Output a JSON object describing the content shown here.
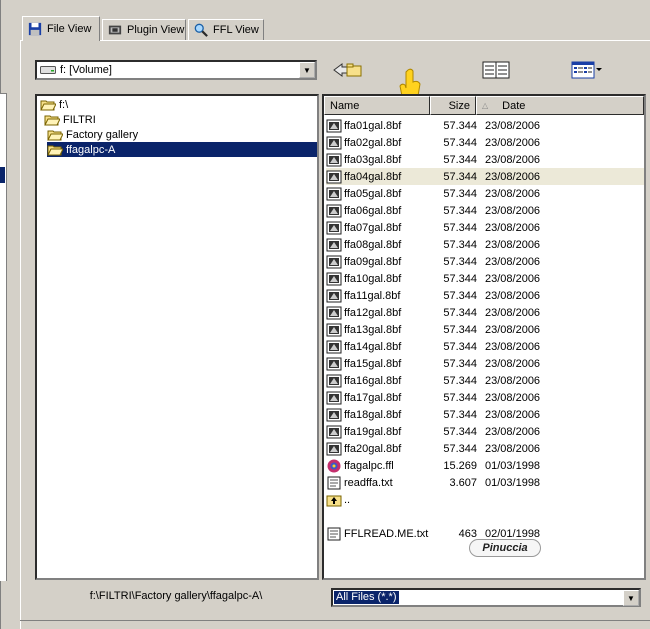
{
  "tabs": [
    {
      "label": "File View",
      "icon": "floppy-disk-icon"
    },
    {
      "label": "Plugin View",
      "icon": "plugin-icon"
    },
    {
      "label": "FFL View",
      "icon": "magnifier-icon"
    }
  ],
  "drive": {
    "label": "f: [Volume]"
  },
  "tree": [
    {
      "label": "f:\\",
      "level": 0
    },
    {
      "label": "FILTRI",
      "level": 1
    },
    {
      "label": "Factory gallery",
      "level": 2
    },
    {
      "label": "ffagalpc-A",
      "level": 3,
      "selected": true
    }
  ],
  "list_headers": {
    "name": "Name",
    "size": "Size",
    "date": "Date"
  },
  "files": [
    {
      "name": "ffa01gal.8bf",
      "size": "57.344",
      "date": "23/08/2006",
      "type": "plugin"
    },
    {
      "name": "ffa02gal.8bf",
      "size": "57.344",
      "date": "23/08/2006",
      "type": "plugin"
    },
    {
      "name": "ffa03gal.8bf",
      "size": "57.344",
      "date": "23/08/2006",
      "type": "plugin"
    },
    {
      "name": "ffa04gal.8bf",
      "size": "57.344",
      "date": "23/08/2006",
      "type": "plugin",
      "hover": true
    },
    {
      "name": "ffa05gal.8bf",
      "size": "57.344",
      "date": "23/08/2006",
      "type": "plugin"
    },
    {
      "name": "ffa06gal.8bf",
      "size": "57.344",
      "date": "23/08/2006",
      "type": "plugin"
    },
    {
      "name": "ffa07gal.8bf",
      "size": "57.344",
      "date": "23/08/2006",
      "type": "plugin"
    },
    {
      "name": "ffa08gal.8bf",
      "size": "57.344",
      "date": "23/08/2006",
      "type": "plugin"
    },
    {
      "name": "ffa09gal.8bf",
      "size": "57.344",
      "date": "23/08/2006",
      "type": "plugin"
    },
    {
      "name": "ffa10gal.8bf",
      "size": "57.344",
      "date": "23/08/2006",
      "type": "plugin"
    },
    {
      "name": "ffa11gal.8bf",
      "size": "57.344",
      "date": "23/08/2006",
      "type": "plugin"
    },
    {
      "name": "ffa12gal.8bf",
      "size": "57.344",
      "date": "23/08/2006",
      "type": "plugin"
    },
    {
      "name": "ffa13gal.8bf",
      "size": "57.344",
      "date": "23/08/2006",
      "type": "plugin"
    },
    {
      "name": "ffa14gal.8bf",
      "size": "57.344",
      "date": "23/08/2006",
      "type": "plugin"
    },
    {
      "name": "ffa15gal.8bf",
      "size": "57.344",
      "date": "23/08/2006",
      "type": "plugin"
    },
    {
      "name": "ffa16gal.8bf",
      "size": "57.344",
      "date": "23/08/2006",
      "type": "plugin"
    },
    {
      "name": "ffa17gal.8bf",
      "size": "57.344",
      "date": "23/08/2006",
      "type": "plugin"
    },
    {
      "name": "ffa18gal.8bf",
      "size": "57.344",
      "date": "23/08/2006",
      "type": "plugin"
    },
    {
      "name": "ffa19gal.8bf",
      "size": "57.344",
      "date": "23/08/2006",
      "type": "plugin"
    },
    {
      "name": "ffa20gal.8bf",
      "size": "57.344",
      "date": "23/08/2006",
      "type": "plugin"
    },
    {
      "name": "ffagalpc.ffl",
      "size": "15.269",
      "date": "01/03/1998",
      "type": "ffl"
    },
    {
      "name": "readffa.txt",
      "size": "3.607",
      "date": "01/03/1998",
      "type": "text"
    },
    {
      "name": "..",
      "size": "",
      "date": "",
      "type": "up"
    },
    {
      "name": "",
      "size": "",
      "date": "",
      "type": "blank"
    },
    {
      "name": "FFLREAD.ME.txt",
      "size": "463",
      "date": "02/01/1998",
      "type": "text"
    }
  ],
  "logo_text": "Pinuccia",
  "status_path": "f:\\FILTRI\\Factory gallery\\ffagalpc-A\\",
  "filter": {
    "value": "All Files (*.*)"
  },
  "colors": {
    "selection": "#0a246a",
    "face": "#d4d0c8",
    "hover_row": "#ece9d8"
  }
}
